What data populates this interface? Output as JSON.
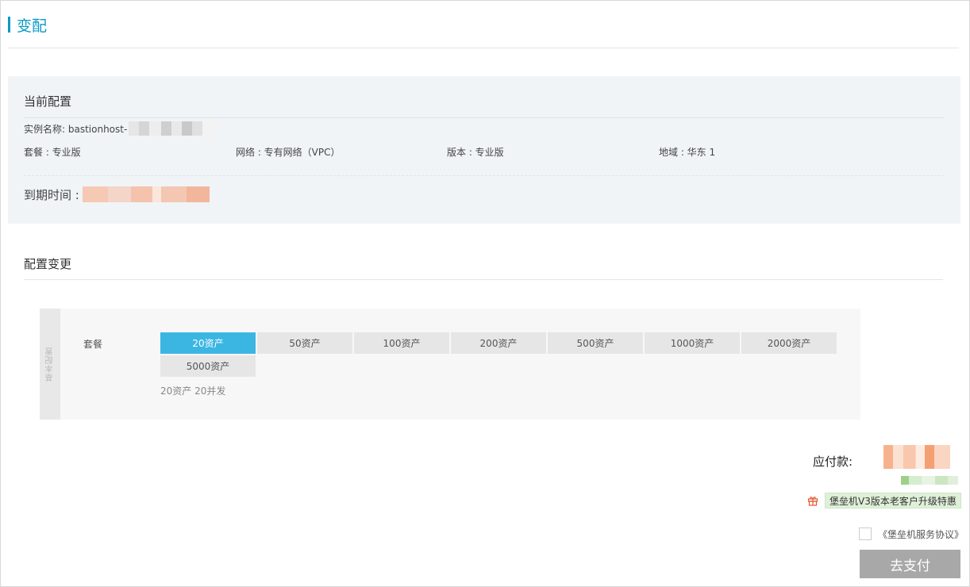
{
  "page": {
    "title": "变配"
  },
  "current": {
    "section_title": "当前配置",
    "instance_name_label": "实例名称: bastionhost-",
    "package": "套餐 : 专业版",
    "network": "网络 : 专有网络（VPC）",
    "edition": "版本 : 专业版",
    "region": "地域 : 华东 1",
    "expire_label": "到期时间 :"
  },
  "change": {
    "section_title": "配置变更",
    "side_label": "基本配置",
    "package_label": "套餐",
    "options": [
      "20资产",
      "50资产",
      "100资产",
      "200资产",
      "500资产",
      "1000资产",
      "2000资产",
      "5000资产"
    ],
    "selected": "20资产",
    "description": "20资产 20并发"
  },
  "payment": {
    "amount_label": "应付款:",
    "promo_text": "堡垒机V3版本老客户升级特惠",
    "agreement_text": "《堡垒机服务协议》",
    "pay_button": "去支付"
  },
  "colors": {
    "accent": "#0a9bc4",
    "selected_option": "#3bb6e3",
    "pay_button_disabled": "#a8a8a8"
  }
}
